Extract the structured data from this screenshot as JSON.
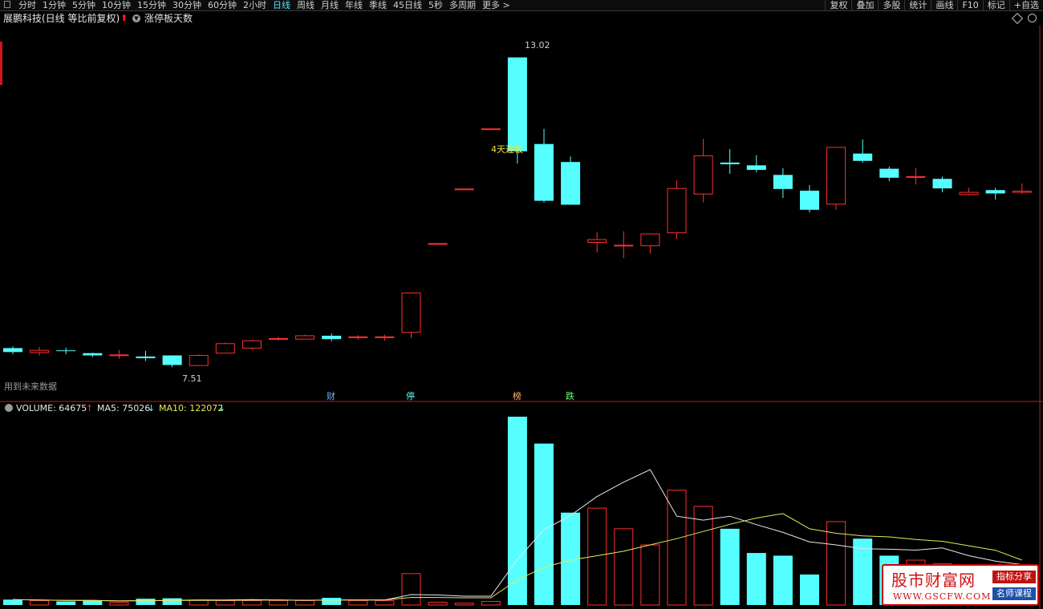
{
  "toolbar": {
    "periods": [
      "分时",
      "1分钟",
      "5分钟",
      "10分钟",
      "15分钟",
      "30分钟",
      "60分钟",
      "2小时",
      "日线",
      "周线",
      "月线",
      "年线",
      "季线",
      "45日线",
      "5秒",
      "多周期",
      "更多 >"
    ],
    "active_period": "日线",
    "right_tools": [
      "复权",
      "叠加",
      "多股",
      "统计",
      "画线",
      "F10",
      "标记",
      "+自选"
    ]
  },
  "title": {
    "stock": "展鹏科技(日线 等比前复权)",
    "indicator": "涨停板天数"
  },
  "main_chart": {
    "high_label": "13.02",
    "low_label": "7.51",
    "streak_label": "4天连板",
    "future_note": "用到未来数据",
    "events": [
      "财",
      "停",
      "榜",
      "跌"
    ]
  },
  "volume_panel": {
    "volume_label": "VOLUME: 64675",
    "ma5_label": "MA5: 75026",
    "ma10_label": "MA10: 122072"
  },
  "colors": {
    "up": "#ff3030",
    "down": "#55ffff",
    "ma5": "#e8e8e8",
    "ma10": "#e8e85a"
  },
  "logo": {
    "name": "股市财富网",
    "url": "WWW.GSCFW.COM",
    "tag1": "指标分享",
    "tag2": "名师课程"
  },
  "chart_data": {
    "type": "candlestick",
    "price_range": [
      7.3,
      13.3
    ],
    "candles": [
      {
        "o": 7.85,
        "c": 7.78,
        "h": 7.88,
        "l": 7.74
      },
      {
        "o": 7.77,
        "c": 7.81,
        "h": 7.87,
        "l": 7.72
      },
      {
        "o": 7.81,
        "c": 7.8,
        "h": 7.86,
        "l": 7.74
      },
      {
        "o": 7.76,
        "c": 7.72,
        "h": 7.77,
        "l": 7.69
      },
      {
        "o": 7.73,
        "c": 7.73,
        "h": 7.82,
        "l": 7.66
      },
      {
        "o": 7.7,
        "c": 7.67,
        "h": 7.8,
        "l": 7.62
      },
      {
        "o": 7.72,
        "c": 7.55,
        "h": 7.72,
        "l": 7.51
      },
      {
        "o": 7.54,
        "c": 7.72,
        "h": 7.74,
        "l": 7.53
      },
      {
        "o": 7.76,
        "c": 7.93,
        "h": 7.95,
        "l": 7.76
      },
      {
        "o": 7.85,
        "c": 7.98,
        "h": 8.0,
        "l": 7.82
      },
      {
        "o": 8.02,
        "c": 8.02,
        "h": 8.05,
        "l": 7.98
      },
      {
        "o": 8.01,
        "c": 8.07,
        "h": 8.09,
        "l": 8.01
      },
      {
        "o": 8.07,
        "c": 8.01,
        "h": 8.11,
        "l": 7.97
      },
      {
        "o": 8.05,
        "c": 8.05,
        "h": 8.08,
        "l": 8.0
      },
      {
        "o": 8.05,
        "c": 8.05,
        "h": 8.09,
        "l": 7.98
      },
      {
        "o": 8.13,
        "c": 8.83,
        "h": 8.83,
        "l": 8.03
      },
      {
        "o": 9.71,
        "c": 9.71,
        "h": 9.71,
        "l": 9.71
      },
      {
        "o": 10.68,
        "c": 10.68,
        "h": 10.68,
        "l": 10.68
      },
      {
        "o": 11.75,
        "c": 11.75,
        "h": 11.75,
        "l": 11.75
      },
      {
        "o": 13.02,
        "c": 11.35,
        "h": 13.02,
        "l": 11.13
      },
      {
        "o": 11.48,
        "c": 10.47,
        "h": 11.75,
        "l": 10.44
      },
      {
        "o": 11.16,
        "c": 10.4,
        "h": 11.26,
        "l": 10.4
      },
      {
        "o": 9.73,
        "c": 9.78,
        "h": 9.91,
        "l": 9.55
      },
      {
        "o": 9.68,
        "c": 9.68,
        "h": 9.93,
        "l": 9.45
      },
      {
        "o": 9.67,
        "c": 9.88,
        "h": 9.89,
        "l": 9.53
      },
      {
        "o": 9.9,
        "c": 10.69,
        "h": 10.83,
        "l": 9.79
      },
      {
        "o": 10.59,
        "c": 11.27,
        "h": 11.57,
        "l": 10.44
      },
      {
        "o": 11.15,
        "c": 11.12,
        "h": 11.39,
        "l": 10.95
      },
      {
        "o": 11.1,
        "c": 11.02,
        "h": 11.28,
        "l": 10.98
      },
      {
        "o": 10.93,
        "c": 10.68,
        "h": 11.05,
        "l": 10.52
      },
      {
        "o": 10.65,
        "c": 10.31,
        "h": 10.75,
        "l": 10.26
      },
      {
        "o": 10.41,
        "c": 11.42,
        "h": 11.42,
        "l": 10.31
      },
      {
        "o": 11.31,
        "c": 11.18,
        "h": 11.56,
        "l": 11.15
      },
      {
        "o": 11.04,
        "c": 10.88,
        "h": 11.08,
        "l": 10.82
      },
      {
        "o": 10.9,
        "c": 10.9,
        "h": 11.05,
        "l": 10.76
      },
      {
        "o": 10.86,
        "c": 10.69,
        "h": 10.9,
        "l": 10.62
      },
      {
        "o": 10.58,
        "c": 10.62,
        "h": 10.7,
        "l": 10.56
      },
      {
        "o": 10.66,
        "c": 10.6,
        "h": 10.7,
        "l": 10.49
      },
      {
        "o": 10.62,
        "c": 10.64,
        "h": 10.78,
        "l": 10.59
      }
    ],
    "volume_range": [
      0,
      210000
    ],
    "volume": [
      6000,
      5000,
      4000,
      5000,
      3000,
      7000,
      7500,
      5500,
      5000,
      5000,
      5000,
      5000,
      8000,
      5000,
      5000,
      35000,
      3000,
      2000,
      4000,
      210000,
      180000,
      103000,
      108000,
      85000,
      67000,
      128000,
      110000,
      85000,
      58000,
      55000,
      34000,
      93000,
      74000,
      55000,
      50000,
      46000,
      40000,
      35000,
      32000
    ],
    "ma5": [
      6000,
      5500,
      5200,
      5100,
      4600,
      4800,
      5300,
      5600,
      5600,
      6000,
      5600,
      5100,
      5600,
      5600,
      5600,
      11600,
      11200,
      9800,
      9800,
      50800,
      84000,
      99800,
      121000,
      137000,
      151000,
      99000,
      94600,
      99000,
      89600,
      81000,
      70400,
      67000,
      62800,
      62200,
      61200,
      63600,
      55000,
      49000,
      45000
    ],
    "ma10": [
      6000,
      5500,
      5200,
      5100,
      4600,
      4800,
      5000,
      5200,
      5200,
      5400,
      5500,
      5400,
      5500,
      5500,
      5500,
      8500,
      8400,
      8000,
      8000,
      28000,
      42000,
      50000,
      55000,
      60000,
      67000,
      74000,
      82000,
      90000,
      97000,
      102000,
      85000,
      80000,
      77000,
      76000,
      73000,
      71000,
      66000,
      61000,
      50000
    ]
  }
}
